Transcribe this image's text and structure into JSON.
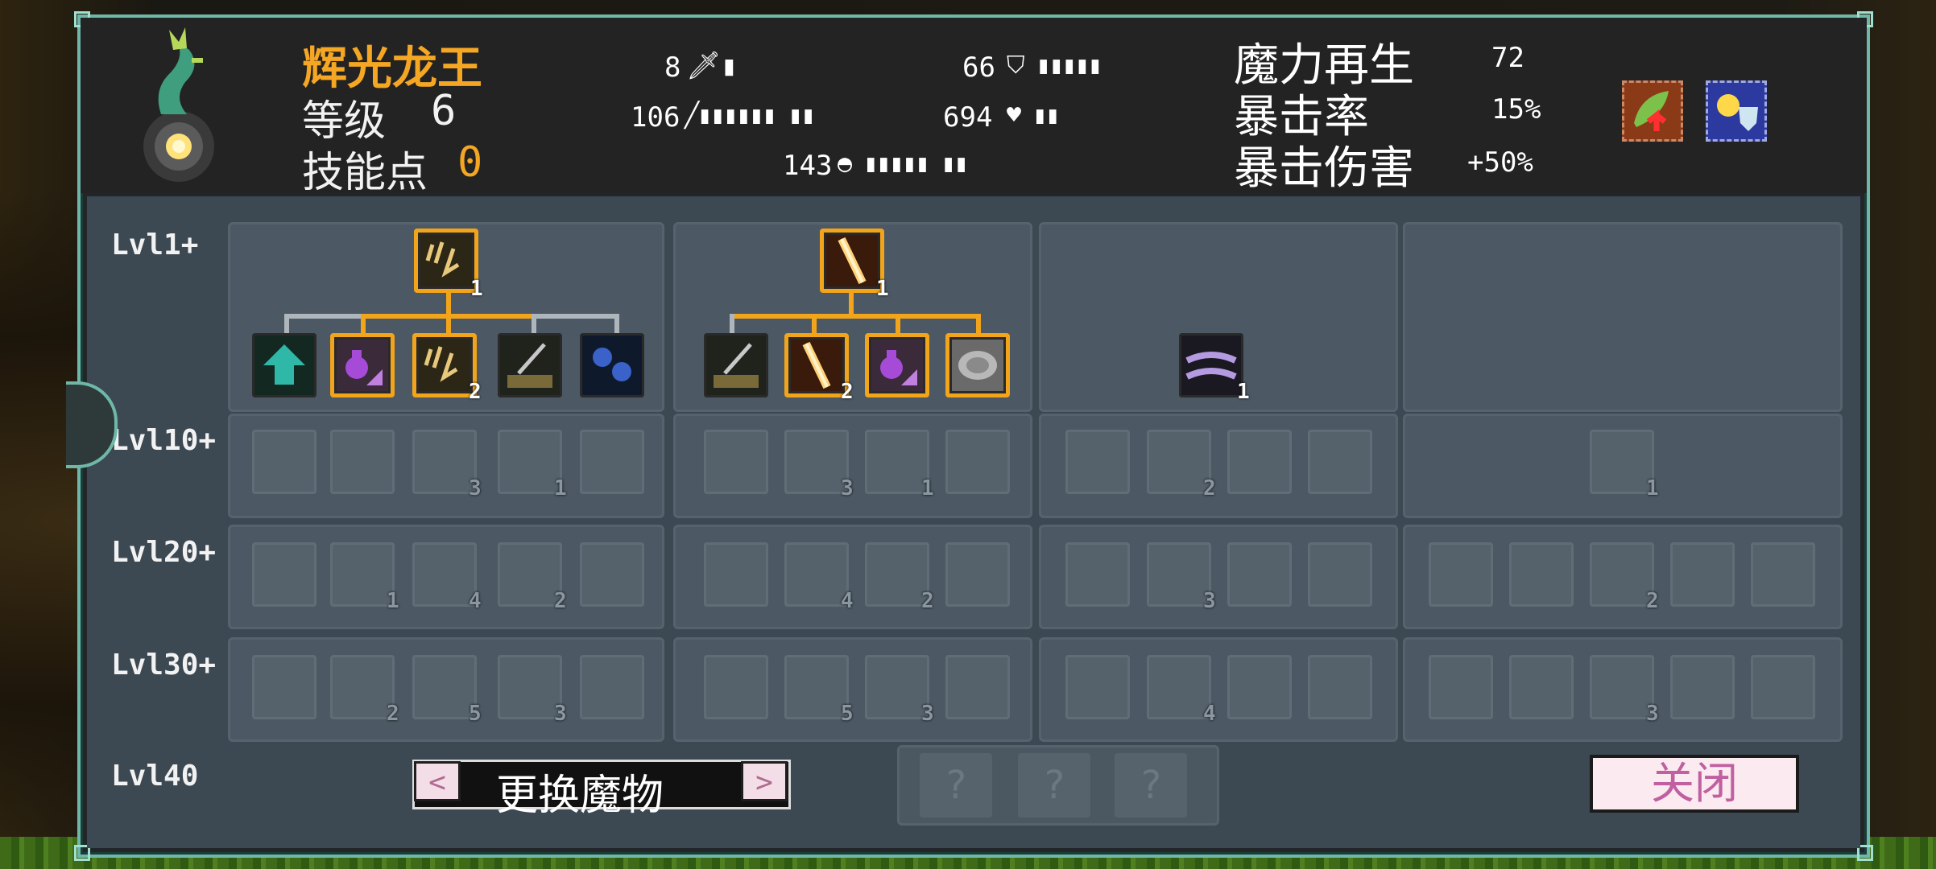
{
  "monster": {
    "name": "辉光龙王",
    "level_label": "等级",
    "level": "6",
    "skill_points_label": "技能点",
    "skill_points": "0"
  },
  "stats": {
    "attack": "8",
    "damage": "106",
    "speed": "143",
    "defense": "66",
    "hp": "694",
    "mana_regen_label": "魔力再生",
    "mana_regen": "72",
    "crit_rate_label": "暴击率",
    "crit_rate": "15%",
    "crit_dmg_label": "暴击伤害",
    "crit_dmg": "+50%"
  },
  "levels": [
    "Lvl1+",
    "Lvl10+",
    "Lvl20+",
    "Lvl30+",
    "Lvl40"
  ],
  "tree": {
    "col1": {
      "top_count": "1",
      "row1_counts": [
        "",
        "",
        "2",
        "",
        ""
      ],
      "row2_counts": [
        "",
        "",
        "3",
        "1",
        ""
      ],
      "row3_counts": [
        "",
        "1",
        "4",
        "2",
        ""
      ],
      "row4_counts": [
        "",
        "2",
        "5",
        "3",
        ""
      ]
    },
    "col2": {
      "top_count": "1",
      "row1_counts": [
        "",
        "2",
        "",
        ""
      ],
      "row2_counts": [
        "",
        "3",
        "1",
        ""
      ],
      "row3_counts": [
        "",
        "4",
        "2",
        ""
      ],
      "row4_counts": [
        "",
        "5",
        "3",
        ""
      ]
    },
    "col3": {
      "top_count": "1",
      "row2_counts": [
        "",
        "2",
        "",
        ""
      ],
      "row3_counts": [
        "",
        "3",
        "",
        ""
      ],
      "row4_counts": [
        "",
        "4",
        "",
        ""
      ]
    },
    "col4": {
      "row2_counts": [
        "1"
      ],
      "row3_counts": [
        "",
        "",
        "2",
        "",
        ""
      ],
      "row4_counts": [
        "",
        "",
        "3",
        "",
        ""
      ]
    }
  },
  "bottom": {
    "change_label": "更换魔物",
    "prev": "<",
    "next": ">",
    "question_marks": [
      "?",
      "?",
      "?"
    ],
    "close_label": "关闭"
  },
  "colors": {
    "accent": "#f2a41a",
    "name": "#f5a623",
    "frame": "#6fb7a9"
  }
}
